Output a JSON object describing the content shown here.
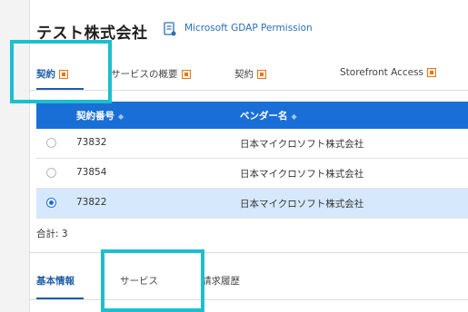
{
  "header": {
    "title": "テスト株式会社",
    "link_label": "Microsoft GDAP Permission"
  },
  "tabs": [
    {
      "label": "契約",
      "active": true
    },
    {
      "label": "サービスの概要",
      "active": false
    },
    {
      "label": "契約",
      "active": false
    },
    {
      "label": "Storefront Access",
      "active": false
    }
  ],
  "table": {
    "columns": [
      "契約番号",
      "ベンダー名"
    ],
    "rows": [
      {
        "contract_no": "73832",
        "vendor": "日本マイクロソフト株式会社",
        "selected": false
      },
      {
        "contract_no": "73854",
        "vendor": "日本マイクロソフト株式会社",
        "selected": false
      },
      {
        "contract_no": "73822",
        "vendor": "日本マイクロソフト株式会社",
        "selected": true
      }
    ],
    "total_label": "合計: 3"
  },
  "subtabs": [
    {
      "label": "基本情報",
      "active": true
    },
    {
      "label": "サービス",
      "active": false
    },
    {
      "label": "請求履歴",
      "active": false
    }
  ],
  "colors": {
    "accent": "#1f5fa8",
    "table_header": "#1a6fd6",
    "selected_row": "#d6e8fb",
    "highlight": "#1bbfcf",
    "tab_icon": "#e8761b"
  }
}
